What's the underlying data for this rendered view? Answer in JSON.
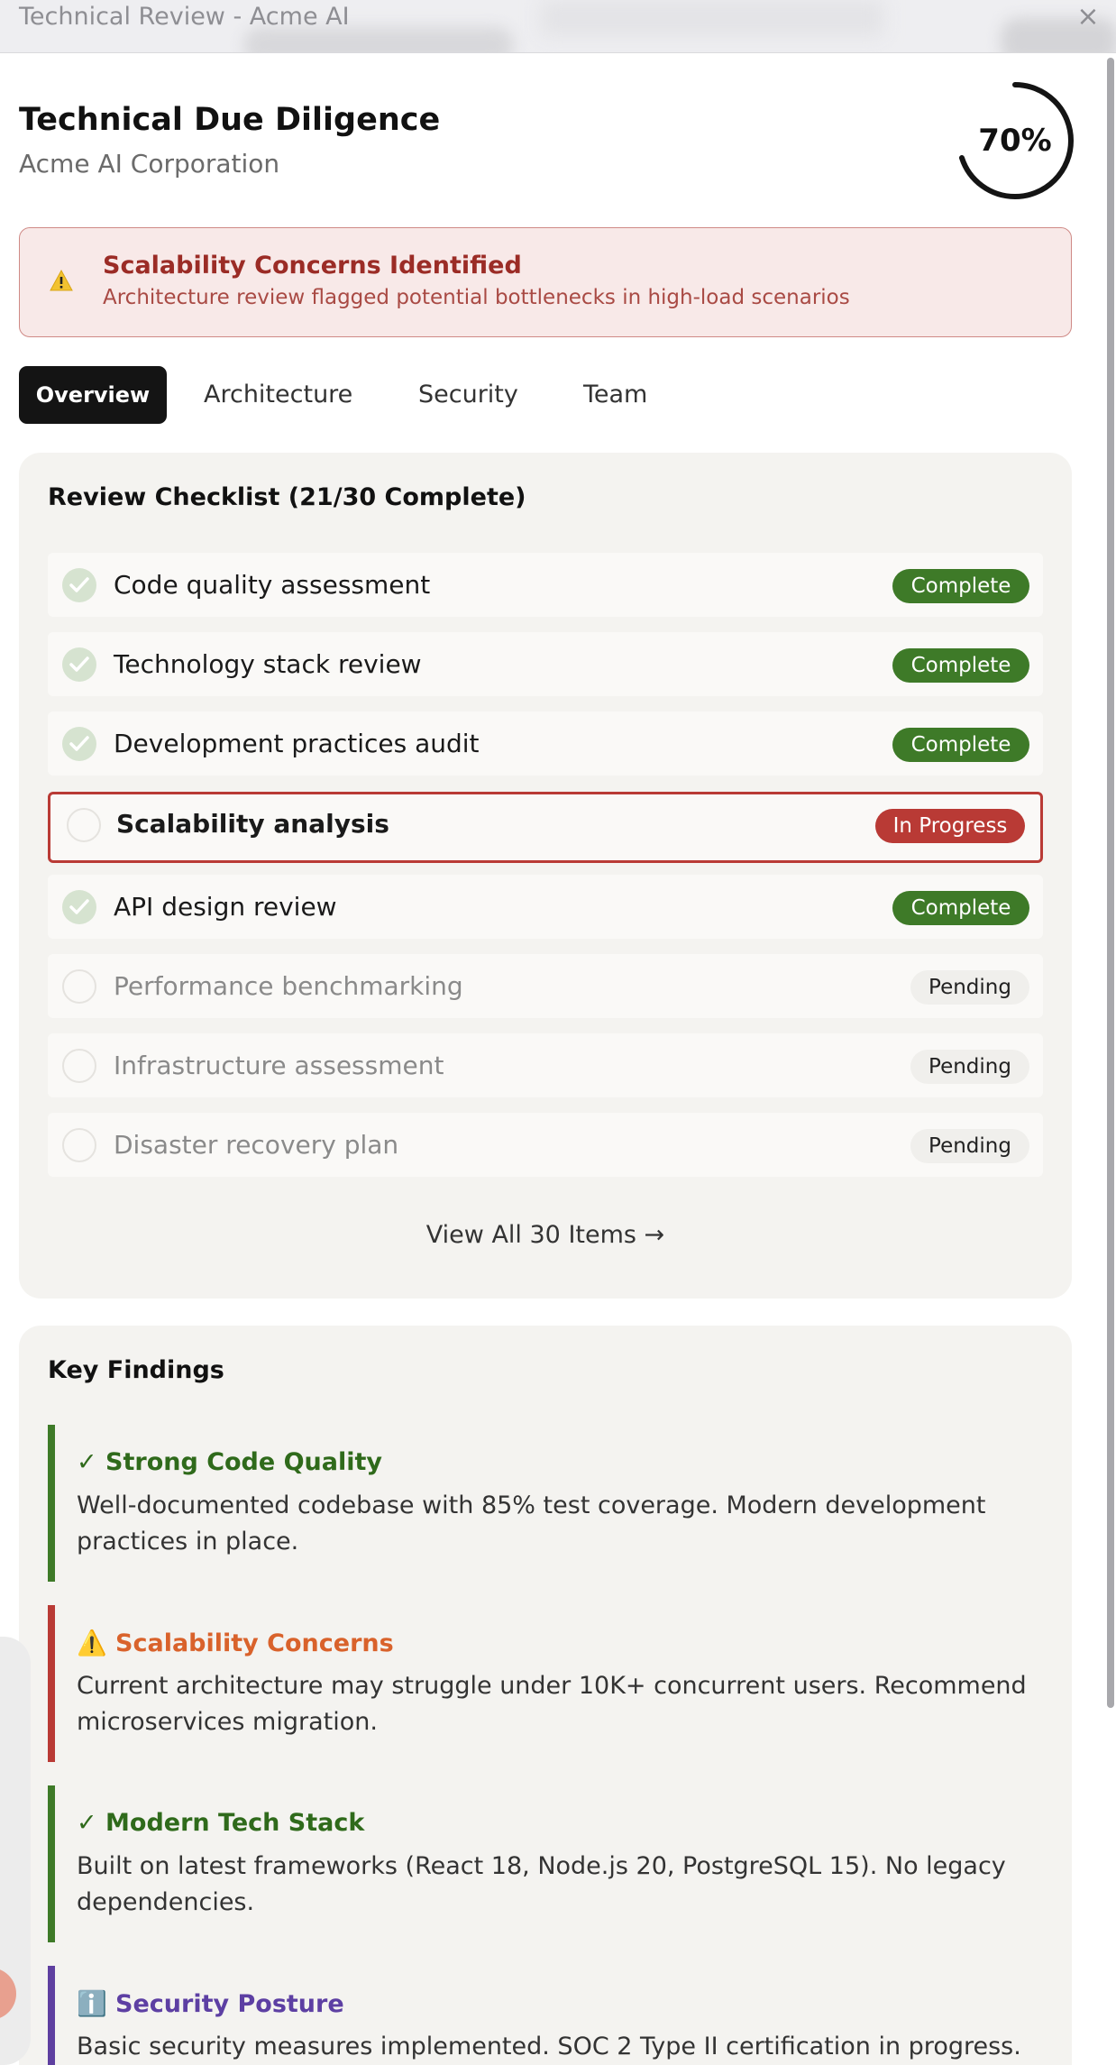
{
  "window": {
    "title": "Technical Review - Acme AI",
    "close_glyph": "×"
  },
  "header": {
    "title": "Technical Due Diligence",
    "subtitle": "Acme AI Corporation",
    "progress_text": "70%",
    "progress_value": 0.7
  },
  "alert": {
    "icon": "warning-icon",
    "title": "Scalability Concerns Identified",
    "description": "Architecture review flagged potential bottlenecks in high-load scenarios"
  },
  "tabs": [
    {
      "label": "Overview",
      "active": true
    },
    {
      "label": "Architecture",
      "active": false
    },
    {
      "label": "Security",
      "active": false
    },
    {
      "label": "Team",
      "active": false
    }
  ],
  "checklist": {
    "title": "Review Checklist (21/30 Complete)",
    "items": [
      {
        "label": "Code quality assessment",
        "status": "Complete"
      },
      {
        "label": "Technology stack review",
        "status": "Complete"
      },
      {
        "label": "Development practices audit",
        "status": "Complete"
      },
      {
        "label": "Scalability analysis",
        "status": "In Progress"
      },
      {
        "label": "API design review",
        "status": "Complete"
      },
      {
        "label": "Performance benchmarking",
        "status": "Pending"
      },
      {
        "label": "Infrastructure assessment",
        "status": "Pending"
      },
      {
        "label": "Disaster recovery plan",
        "status": "Pending"
      }
    ],
    "view_all": "View All 30 Items →"
  },
  "findings": {
    "title": "Key Findings",
    "items": [
      {
        "icon": "checkmark-icon",
        "prefix": "✓",
        "title": "Strong Code Quality",
        "description": "Well-documented codebase with 85% test coverage. Modern development practices in place."
      },
      {
        "icon": "warning-icon",
        "prefix": "⚠️",
        "title": "Scalability Concerns",
        "description": "Current architecture may struggle under 10K+ concurrent users. Recommend microservices migration."
      },
      {
        "icon": "checkmark-icon",
        "prefix": "✓",
        "title": "Modern Tech Stack",
        "description": "Built on latest frameworks (React 18, Node.js 20, PostgreSQL 15). No legacy dependencies."
      },
      {
        "icon": "info-icon",
        "prefix": "ℹ️",
        "title": "Security Posture",
        "description": "Basic security measures implemented. SOC 2 Type II certification in progress."
      }
    ]
  },
  "colors": {
    "complete": "#3e7a28",
    "in_progress": "#b93a35",
    "alert_bg": "#f8e9e8",
    "accent_dark": "#141414"
  }
}
